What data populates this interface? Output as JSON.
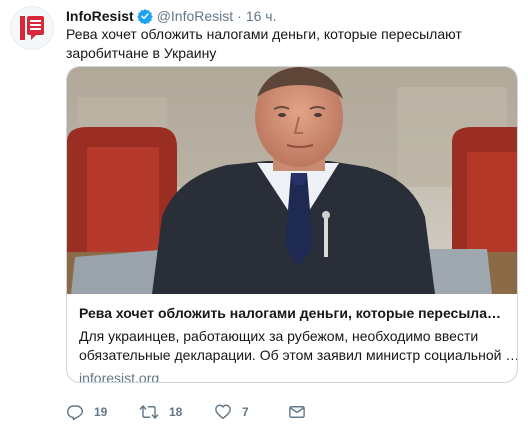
{
  "tweet": {
    "display_name": "InfoResist",
    "handle": "@InfoResist",
    "separator": "·",
    "time": "16 ч.",
    "text": "Рева хочет обложить налогами деньги, которые пересылают заробитчане в Украину"
  },
  "card": {
    "title": "Рева хочет обложить налогами деньги, которые пересылают зар…",
    "description_line1": "Для украинцев, работающих за рубежом, необходимо ввести",
    "description_line2": "обязательные декларации. Об этом заявил министр социальной …",
    "domain": "inforesist.org"
  },
  "actions": {
    "reply_count": "19",
    "retweet_count": "18",
    "like_count": "7"
  },
  "icons": {
    "avatar": "inforesist-logo-icon",
    "verified": "verified-badge-icon",
    "reply": "reply-icon",
    "retweet": "retweet-icon",
    "like": "heart-icon",
    "message": "envelope-icon"
  },
  "colors": {
    "brand_red": "#e0245e",
    "verified_blue": "#1da1f2",
    "text_primary": "#14171a",
    "text_secondary": "#657786",
    "border": "#ccd6dd"
  }
}
